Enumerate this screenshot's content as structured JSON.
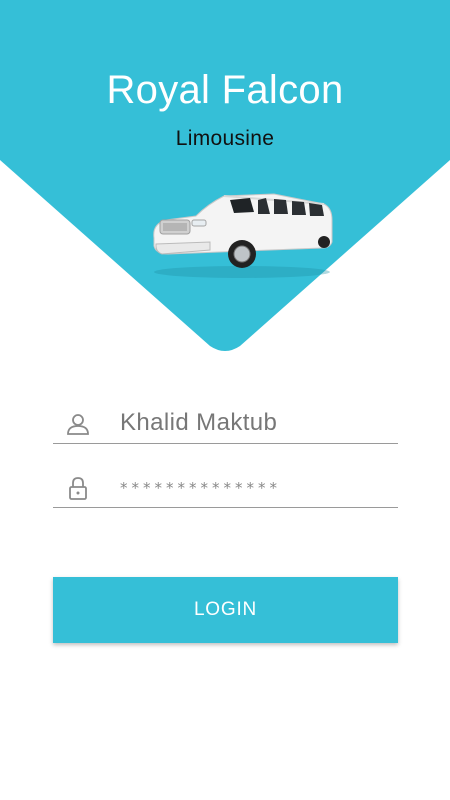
{
  "colors": {
    "accent": "#35bfd7",
    "title": "#ffffff",
    "subtitle": "#111111"
  },
  "header": {
    "title": "Royal Falcon",
    "subtitle": "Limousine"
  },
  "hero": {
    "image": "white-stretch-limousine"
  },
  "form": {
    "username": {
      "icon": "user-icon",
      "value": "Khalid Maktub"
    },
    "password": {
      "icon": "lock-icon",
      "masked_value": "**************"
    },
    "login_label": "LOGIN"
  }
}
